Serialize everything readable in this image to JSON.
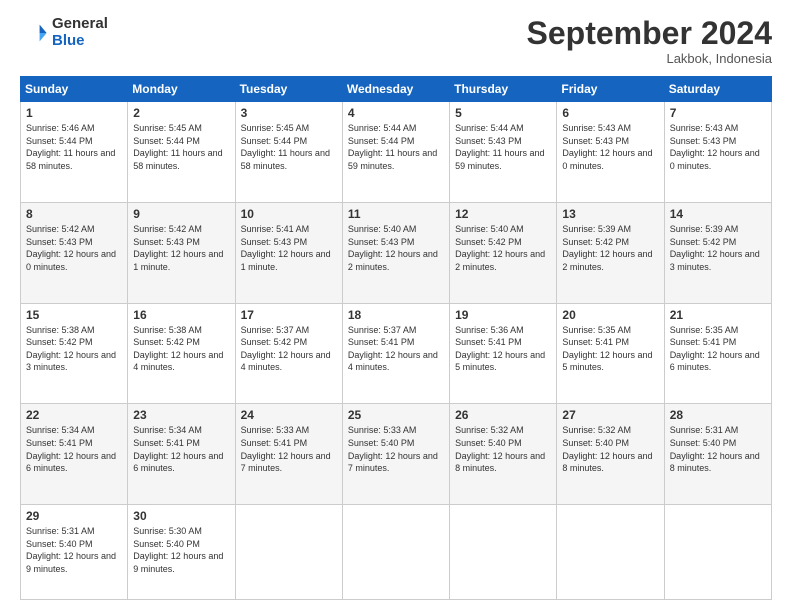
{
  "header": {
    "logo_general": "General",
    "logo_blue": "Blue",
    "month_title": "September 2024",
    "location": "Lakbok, Indonesia"
  },
  "days_of_week": [
    "Sunday",
    "Monday",
    "Tuesday",
    "Wednesday",
    "Thursday",
    "Friday",
    "Saturday"
  ],
  "weeks": [
    [
      {
        "day": "1",
        "sunrise": "5:46 AM",
        "sunset": "5:44 PM",
        "daylight": "11 hours and 58 minutes."
      },
      {
        "day": "2",
        "sunrise": "5:45 AM",
        "sunset": "5:44 PM",
        "daylight": "11 hours and 58 minutes."
      },
      {
        "day": "3",
        "sunrise": "5:45 AM",
        "sunset": "5:44 PM",
        "daylight": "11 hours and 58 minutes."
      },
      {
        "day": "4",
        "sunrise": "5:44 AM",
        "sunset": "5:44 PM",
        "daylight": "11 hours and 59 minutes."
      },
      {
        "day": "5",
        "sunrise": "5:44 AM",
        "sunset": "5:43 PM",
        "daylight": "11 hours and 59 minutes."
      },
      {
        "day": "6",
        "sunrise": "5:43 AM",
        "sunset": "5:43 PM",
        "daylight": "12 hours and 0 minutes."
      },
      {
        "day": "7",
        "sunrise": "5:43 AM",
        "sunset": "5:43 PM",
        "daylight": "12 hours and 0 minutes."
      }
    ],
    [
      {
        "day": "8",
        "sunrise": "5:42 AM",
        "sunset": "5:43 PM",
        "daylight": "12 hours and 0 minutes."
      },
      {
        "day": "9",
        "sunrise": "5:42 AM",
        "sunset": "5:43 PM",
        "daylight": "12 hours and 1 minute."
      },
      {
        "day": "10",
        "sunrise": "5:41 AM",
        "sunset": "5:43 PM",
        "daylight": "12 hours and 1 minute."
      },
      {
        "day": "11",
        "sunrise": "5:40 AM",
        "sunset": "5:43 PM",
        "daylight": "12 hours and 2 minutes."
      },
      {
        "day": "12",
        "sunrise": "5:40 AM",
        "sunset": "5:42 PM",
        "daylight": "12 hours and 2 minutes."
      },
      {
        "day": "13",
        "sunrise": "5:39 AM",
        "sunset": "5:42 PM",
        "daylight": "12 hours and 2 minutes."
      },
      {
        "day": "14",
        "sunrise": "5:39 AM",
        "sunset": "5:42 PM",
        "daylight": "12 hours and 3 minutes."
      }
    ],
    [
      {
        "day": "15",
        "sunrise": "5:38 AM",
        "sunset": "5:42 PM",
        "daylight": "12 hours and 3 minutes."
      },
      {
        "day": "16",
        "sunrise": "5:38 AM",
        "sunset": "5:42 PM",
        "daylight": "12 hours and 4 minutes."
      },
      {
        "day": "17",
        "sunrise": "5:37 AM",
        "sunset": "5:42 PM",
        "daylight": "12 hours and 4 minutes."
      },
      {
        "day": "18",
        "sunrise": "5:37 AM",
        "sunset": "5:41 PM",
        "daylight": "12 hours and 4 minutes."
      },
      {
        "day": "19",
        "sunrise": "5:36 AM",
        "sunset": "5:41 PM",
        "daylight": "12 hours and 5 minutes."
      },
      {
        "day": "20",
        "sunrise": "5:35 AM",
        "sunset": "5:41 PM",
        "daylight": "12 hours and 5 minutes."
      },
      {
        "day": "21",
        "sunrise": "5:35 AM",
        "sunset": "5:41 PM",
        "daylight": "12 hours and 6 minutes."
      }
    ],
    [
      {
        "day": "22",
        "sunrise": "5:34 AM",
        "sunset": "5:41 PM",
        "daylight": "12 hours and 6 minutes."
      },
      {
        "day": "23",
        "sunrise": "5:34 AM",
        "sunset": "5:41 PM",
        "daylight": "12 hours and 6 minutes."
      },
      {
        "day": "24",
        "sunrise": "5:33 AM",
        "sunset": "5:41 PM",
        "daylight": "12 hours and 7 minutes."
      },
      {
        "day": "25",
        "sunrise": "5:33 AM",
        "sunset": "5:40 PM",
        "daylight": "12 hours and 7 minutes."
      },
      {
        "day": "26",
        "sunrise": "5:32 AM",
        "sunset": "5:40 PM",
        "daylight": "12 hours and 8 minutes."
      },
      {
        "day": "27",
        "sunrise": "5:32 AM",
        "sunset": "5:40 PM",
        "daylight": "12 hours and 8 minutes."
      },
      {
        "day": "28",
        "sunrise": "5:31 AM",
        "sunset": "5:40 PM",
        "daylight": "12 hours and 8 minutes."
      }
    ],
    [
      {
        "day": "29",
        "sunrise": "5:31 AM",
        "sunset": "5:40 PM",
        "daylight": "12 hours and 9 minutes."
      },
      {
        "day": "30",
        "sunrise": "5:30 AM",
        "sunset": "5:40 PM",
        "daylight": "12 hours and 9 minutes."
      },
      null,
      null,
      null,
      null,
      null
    ]
  ]
}
